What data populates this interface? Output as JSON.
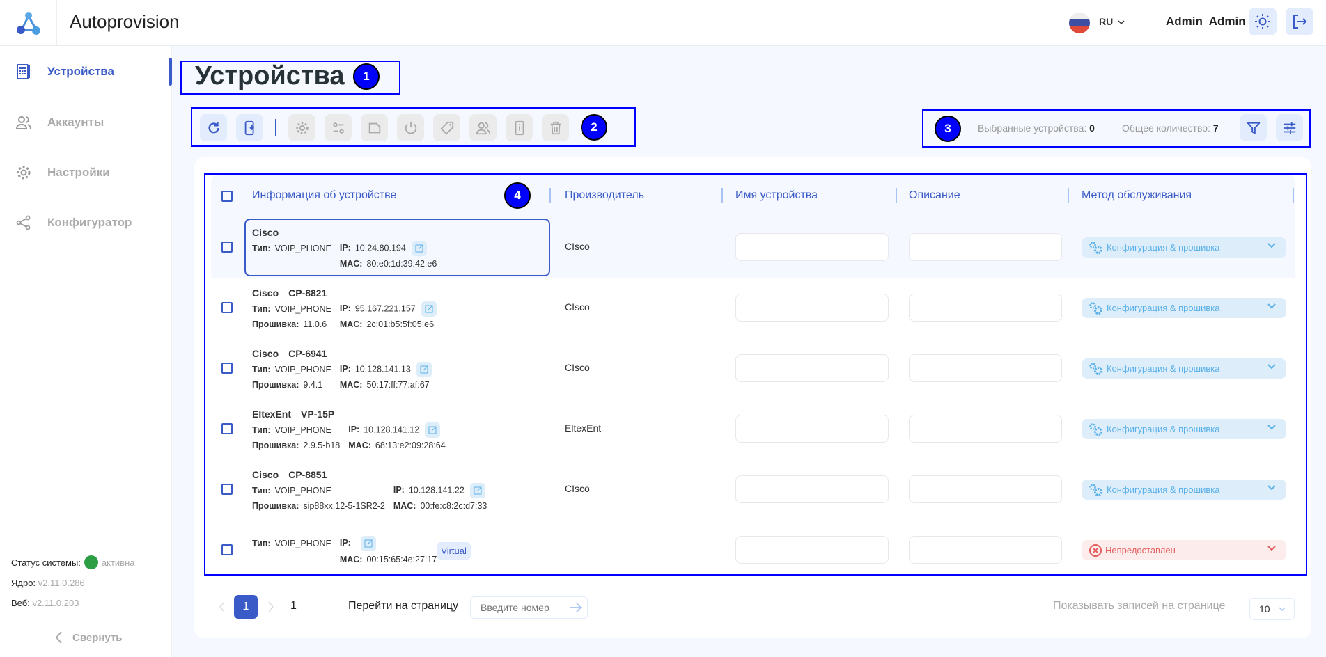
{
  "header": {
    "app_title": "Autoprovision",
    "lang": "RU",
    "user": "Admin  Admin",
    "icons": [
      "logo-icon",
      "flag-ru-icon",
      "chevron-down-icon",
      "sun-icon",
      "logout-icon"
    ]
  },
  "sidebar": {
    "items": [
      {
        "label": "Устройства",
        "icon": "device-icon",
        "active": true
      },
      {
        "label": "Аккаунты",
        "icon": "users-icon"
      },
      {
        "label": "Настройки",
        "icon": "gear-icon"
      },
      {
        "label": "Конфигуратор",
        "icon": "share-icon"
      }
    ],
    "status_label": "Статус системы:",
    "status_value": "активна",
    "status_color": "#2e9e44",
    "core_label": "Ядро:",
    "core_version": "v2.11.0.286",
    "web_label": "Веб:",
    "web_version": "v2.11.0.203",
    "collapse": "Свернуть"
  },
  "page": {
    "title": "Устройства"
  },
  "annotations": [
    "1",
    "2",
    "3",
    "4"
  ],
  "toolbar": {
    "buttons": [
      "refresh-icon",
      "device-import-icon",
      "gear-icon",
      "toggles-icon",
      "file-icon",
      "power-icon",
      "tag-icon",
      "users-icon",
      "device-info-icon",
      "trash-icon"
    ]
  },
  "stats": {
    "selected_label": "Выбранные устройства:",
    "selected": "0",
    "total_label": "Общее количество:",
    "total": "7"
  },
  "table": {
    "columns": [
      "Информация об устройстве",
      "Производитель",
      "Имя устройства",
      "Описание",
      "Метод обслуживания"
    ],
    "labels": {
      "type": "Тип:",
      "ip": "IP:",
      "fw": "Прошивка:",
      "mac": "MAC:"
    },
    "rows": [
      {
        "vendor": "Cisco",
        "model": "",
        "type": "VOIP_PHONE",
        "ip": "10.24.80.194",
        "fw": "",
        "mac": "80:e0:1d:39:42:e6",
        "manufacturer": "CIsco",
        "method": "Конфигурация & прошивка",
        "virtual": ""
      },
      {
        "vendor": "Cisco",
        "model": "CP-8821",
        "type": "VOIP_PHONE",
        "ip": "95.167.221.157",
        "fw": "11.0.6",
        "mac": "2c:01:b5:5f:05:e6",
        "manufacturer": "CIsco",
        "method": "Конфигурация & прошивка",
        "virtual": ""
      },
      {
        "vendor": "Cisco",
        "model": "CP-6941",
        "type": "VOIP_PHONE",
        "ip": "10.128.141.13",
        "fw": "9.4.1",
        "mac": "50:17:ff:77:af:67",
        "manufacturer": "CIsco",
        "method": "Конфигурация & прошивка",
        "virtual": ""
      },
      {
        "vendor": "EltexEnt",
        "model": "VP-15P",
        "type": "VOIP_PHONE",
        "ip": "10.128.141.12",
        "fw": "2.9.5-b18",
        "mac": "68:13:e2:09:28:64",
        "manufacturer": "EltexEnt",
        "method": "Конфигурация & прошивка",
        "virtual": ""
      },
      {
        "vendor": "Cisco",
        "model": "CP-8851",
        "type": "VOIP_PHONE",
        "ip": "10.128.141.22",
        "fw": "sip88xx.12-5-1SR2-2",
        "mac": "00:fe:c8:2c:d7:33",
        "manufacturer": "CIsco",
        "method": "Конфигурация & прошивка",
        "virtual": ""
      },
      {
        "vendor": "",
        "model": "",
        "type": "VOIP_PHONE",
        "ip": "",
        "fw": "",
        "mac": "00:15:65:4e:27:17",
        "manufacturer": "",
        "method": "Непредоставлен",
        "virtual": "Virtual",
        "error": true
      }
    ]
  },
  "pagination": {
    "current": "1",
    "total_pages": "1",
    "goto_label": "Перейти на страницу",
    "goto_placeholder": "Введите номер",
    "per_page_label": "Показывать записей на странице",
    "per_page": "10"
  },
  "colors": {
    "primary": "#3a5bc7",
    "method_bg": "#ddeefa",
    "error": "#e45c5c",
    "annotation": "#0000ff"
  }
}
